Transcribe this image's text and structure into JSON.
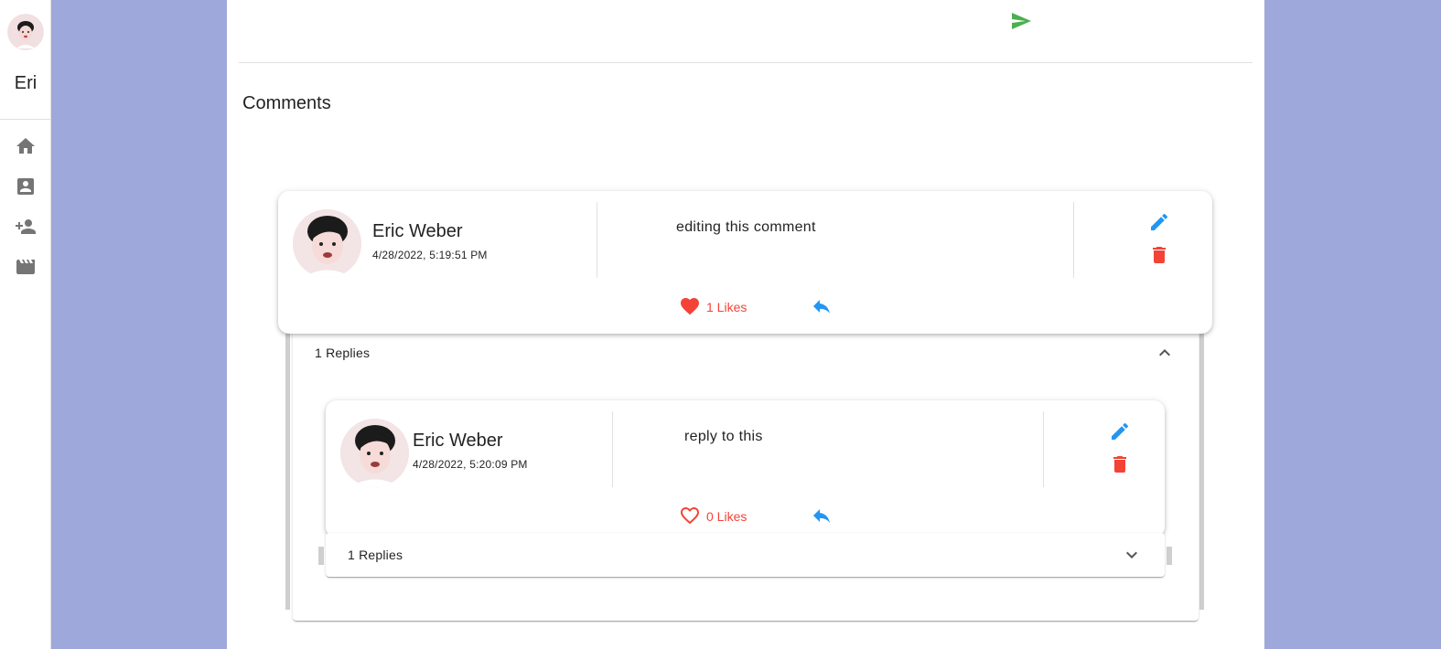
{
  "sidebar": {
    "user_name": "Eri",
    "nav_icons": [
      "home-icon",
      "account-box-icon",
      "person-add-icon",
      "movie-icon"
    ]
  },
  "main": {
    "comments_title": "Comments"
  },
  "comment": {
    "author": "Eric Weber",
    "date": "4/28/2022, 5:19:51 PM",
    "text": "editing this comment",
    "likes_label": "1 Likes",
    "replies_label": "1 Replies"
  },
  "reply": {
    "author": "Eric Weber",
    "date": "4/28/2022, 5:20:09 PM",
    "text": "reply to this",
    "likes_label": "0 Likes",
    "replies_label": "1 Replies"
  },
  "colors": {
    "background": "#9fa8da",
    "send": "#4caf50",
    "edit": "#2196f3",
    "delete": "#f44336",
    "like": "#f44336",
    "reply": "#2196f3"
  }
}
